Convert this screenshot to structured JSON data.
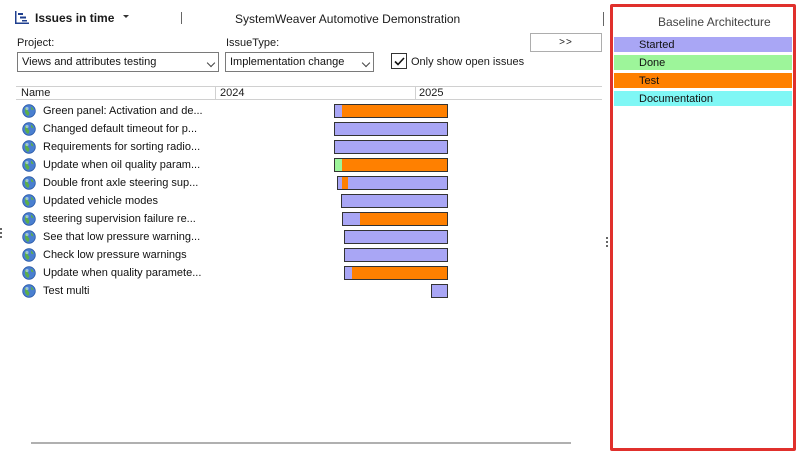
{
  "header": {
    "app_title": "Issues in time",
    "window_title": "SystemWeaver Automotive Demonstration"
  },
  "filters": {
    "project_label": "Project:",
    "project_value": "Views and attributes testing",
    "issuetype_label": "IssueType:",
    "issuetype_value": "Implementation change",
    "expand_label": ">>",
    "only_open_label": "Only show open issues",
    "only_open_checked": true
  },
  "table": {
    "columns": [
      "Name",
      "2024",
      "2025"
    ],
    "rows": [
      {
        "name": "Green panel: Activation and de...",
        "segments": [
          {
            "status": "started",
            "from": 0.0,
            "to": 0.07
          },
          {
            "status": "test",
            "from": 0.07,
            "to": 1.0
          }
        ]
      },
      {
        "name": "Changed default timeout for p...",
        "segments": [
          {
            "status": "started",
            "from": 0.0,
            "to": 1.0
          }
        ]
      },
      {
        "name": "Requirements for sorting radio...",
        "segments": [
          {
            "status": "started",
            "from": 0.0,
            "to": 1.0
          }
        ]
      },
      {
        "name": "Update when oil quality param...",
        "segments": [
          {
            "status": "done",
            "from": 0.0,
            "to": 0.07
          },
          {
            "status": "test",
            "from": 0.07,
            "to": 1.0
          }
        ]
      },
      {
        "name": "Double front axle steering sup...",
        "segments": [
          {
            "status": "started",
            "from": 0.03,
            "to": 0.07
          },
          {
            "status": "test",
            "from": 0.07,
            "to": 0.12
          },
          {
            "status": "started",
            "from": 0.12,
            "to": 1.0
          }
        ]
      },
      {
        "name": "Updated vehicle modes",
        "segments": [
          {
            "status": "started",
            "from": 0.06,
            "to": 1.0
          }
        ]
      },
      {
        "name": "steering supervision failure re...",
        "segments": [
          {
            "status": "started",
            "from": 0.07,
            "to": 0.23
          },
          {
            "status": "test",
            "from": 0.23,
            "to": 1.0
          }
        ]
      },
      {
        "name": "See that low pressure warning...",
        "segments": [
          {
            "status": "started",
            "from": 0.09,
            "to": 1.0
          }
        ]
      },
      {
        "name": "Check low pressure warnings",
        "segments": [
          {
            "status": "started",
            "from": 0.09,
            "to": 1.0
          }
        ]
      },
      {
        "name": "Update when quality paramete...",
        "segments": [
          {
            "status": "started",
            "from": 0.09,
            "to": 0.16
          },
          {
            "status": "test",
            "from": 0.16,
            "to": 1.0
          }
        ]
      },
      {
        "name": "Test multi",
        "segments": [
          {
            "status": "started",
            "from": 0.86,
            "to": 1.0
          }
        ]
      }
    ]
  },
  "legend": {
    "title": "Baseline Architecture",
    "items": [
      {
        "key": "started",
        "label": "Started",
        "color": "#a9a6f5"
      },
      {
        "key": "done",
        "label": "Done",
        "color": "#9df59a"
      },
      {
        "key": "test",
        "label": "Test",
        "color": "#ff8000"
      },
      {
        "key": "documentation",
        "label": "Documentation",
        "color": "#7ff7f5"
      }
    ]
  },
  "colors": {
    "highlight_border": "#e0302c"
  },
  "icons": {
    "title_icon": "timeline-chart-icon",
    "row_icon": "globe-icon",
    "check_icon": "checkmark-icon"
  }
}
